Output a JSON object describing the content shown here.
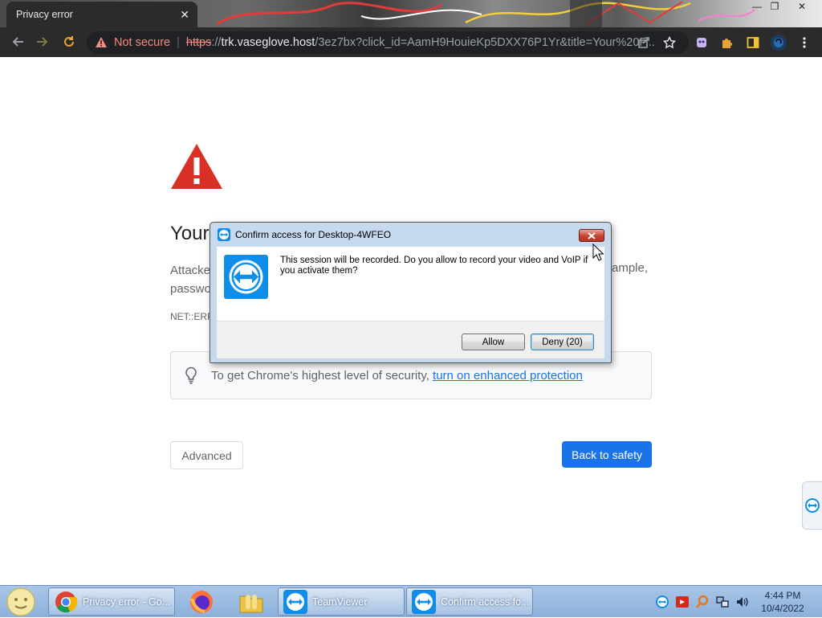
{
  "browser": {
    "tab": {
      "title": "Privacy error",
      "close_glyph": "✕"
    },
    "window_controls": {
      "minimize": "—",
      "maximize": "❐",
      "close": "✕"
    },
    "address_bar": {
      "security_label": "Not secure",
      "separator": "|",
      "url_scheme": "https",
      "url_sep": "://",
      "url_host": "trk.vaseglove.host",
      "url_path": "/3ez7bx?click_id=AamH9HouieKp5DXX76P1Yr&title=Your%20F..."
    }
  },
  "page": {
    "heading": "Your",
    "body_line1": "Attacke",
    "body_line1_right": "ample,",
    "body_line2": "passwo",
    "error_code": "NET::ERR_",
    "enhanced_text": "To get Chrome's highest level of security, ",
    "enhanced_link": "turn on enhanced protection",
    "advanced_button": "Advanced",
    "back_button": "Back to safety"
  },
  "dialog": {
    "title": "Confirm access for Desktop-4WFEO",
    "message": "This session will be recorded. Do you allow to record your video and VoIP if you activate them?",
    "allow_button": "Allow",
    "deny_button": "Deny (20)"
  },
  "taskbar": {
    "items": [
      {
        "label": "Privacy error - Go..."
      },
      {
        "label": "TeamViewer"
      },
      {
        "label": "Confirm access fo..."
      }
    ],
    "clock_time": "4:44 PM",
    "clock_date": "10/4/2022"
  },
  "colors": {
    "chrome_toolbar": "#2b2b2b",
    "not_secure_red": "#f28b82",
    "warning_red": "#d93025",
    "link_blue": "#1a73e8",
    "teamviewer_blue": "#0e8ee9"
  },
  "icons": [
    "back-arrow-icon",
    "forward-arrow-icon",
    "reload-icon",
    "warning-triangle-icon",
    "share-icon",
    "star-icon",
    "extension-icon",
    "puzzle-icon",
    "sidepanel-icon",
    "profile-avatar-icon",
    "kebab-menu-icon",
    "lightbulb-icon",
    "teamviewer-icon",
    "chrome-icon",
    "firefox-icon",
    "folder-icon",
    "speaker-icon",
    "network-icon"
  ]
}
